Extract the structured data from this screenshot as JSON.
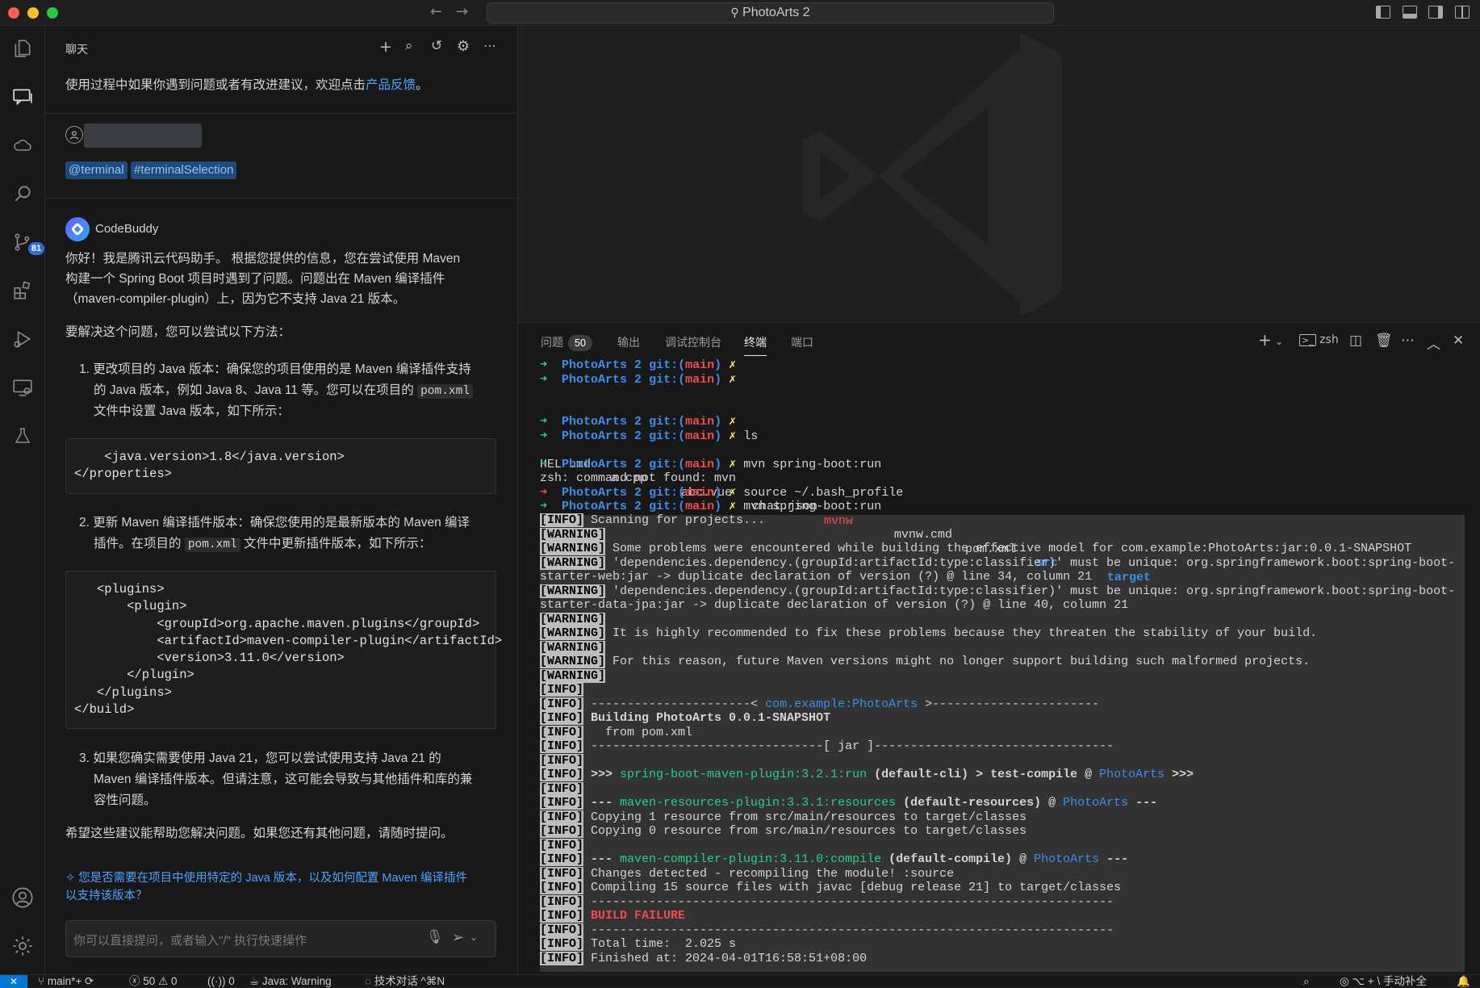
{
  "window": {
    "title": "PhotoArts 2"
  },
  "chat": {
    "header_title": "聊天",
    "feedback_text": "使用过程中如果你遇到问题或者有改进建议，欢迎点击",
    "feedback_link": "产品反馈",
    "feedback_end": "。",
    "tag_terminal": "@terminal",
    "tag_selection": "#terminalSelection",
    "bot_name": "CodeBuddy",
    "intro_1": "你好！我是腾讯云代码助手。  根据您提供的信息，您在尝试使用 Maven",
    "intro_2": "构建一个 Spring Boot 项目时遇到了问题。问题出在 Maven 编译插件",
    "intro_3": "（maven-compiler-plugin）上，因为它不支持 Java 21 版本。",
    "solve_heading": "要解决这个问题，您可以尝试以下方法：",
    "item1_l1": "1. 更改项目的 Java 版本：确保您的项目使用的是 Maven 编译插件支持",
    "item1_l2a": "的 Java 版本，例如 Java 8、Java 11 等。您可以在项目的 ",
    "item1_code": "pom.xml",
    "item1_l3": "文件中设置 Java 版本，如下所示：",
    "code1": "    <java.version>1.8</java.version>\n</properties>",
    "item2_l1": "2. 更新 Maven 编译插件版本：确保您使用的是最新版本的 Maven 编译",
    "item2_l2a": "插件。在项目的 ",
    "item2_code": "pom.xml",
    "item2_l2b": " 文件中更新插件版本，如下所示：",
    "code2": "   <plugins>\n       <plugin>\n           <groupId>org.apache.maven.plugins</groupId>\n           <artifactId>maven-compiler-plugin</artifactId>\n           <version>3.11.0</version>\n       </plugin>\n   </plugins>\n</build>",
    "item3_l1": "3. 如果您确实需要使用 Java 21，您可以尝试使用支持 Java 21 的",
    "item3_l2": "Maven 编译插件版本。但请注意，这可能会导致与其他插件和库的兼",
    "item3_l3": "容性问题。",
    "closing": "希望这些建议能帮助您解决问题。如果您还有其他问题，请随时提问。",
    "suggest_1": "您是否需要在项目中使用特定的 Java 版本，以及如何配置 Maven 编译插件",
    "suggest_2": "以支持该版本？",
    "input_placeholder": "你可以直接提问，或者输入\"/\" 执行快速操作"
  },
  "activity": {
    "scm_badge": "81"
  },
  "panel": {
    "tabs": [
      "问题",
      "输出",
      "调试控制台",
      "终端",
      "端口"
    ],
    "problems_count": "50",
    "active_tab": "终端",
    "shell": "zsh"
  },
  "terminal": {
    "prompt_dir": "PhotoArts 2",
    "prompt_git": "git:(",
    "prompt_branch": "main",
    "prompt_git_end": ")",
    "cmd_ls": "ls",
    "ls_files": [
      "HELP.md",
      "a.cpp",
      "abc.vue",
      "chat.json",
      "mvnw",
      "mvnw.cmd",
      "pom.xml",
      "src",
      "target"
    ],
    "cmd_mvn": "mvn spring-boot:run",
    "not_found": "zsh: command not found: mvn",
    "cmd_source": "source ~/.bash_profile",
    "log": [
      {
        "tag": "[INFO]",
        "text": " Scanning for projects..."
      },
      {
        "tag": "[WARNING]",
        "text": ""
      },
      {
        "tag": "[WARNING]",
        "text": " Some problems were encountered while building the effective model for com.example:PhotoArts:jar:0.0.1-SNAPSHOT"
      },
      {
        "tag": "[WARNING]",
        "text": " 'dependencies.dependency.(groupId:artifactId:type:classifier)' must be unique: org.springframework.boot:spring-boot-"
      },
      {
        "tag": "",
        "text": "starter-web:jar -> duplicate declaration of version (?) @ line 34, column 21"
      },
      {
        "tag": "[WARNING]",
        "text": " 'dependencies.dependency.(groupId:artifactId:type:classifier)' must be unique: org.springframework.boot:spring-boot-"
      },
      {
        "tag": "",
        "text": "starter-data-jpa:jar -> duplicate declaration of version (?) @ line 40, column 21"
      },
      {
        "tag": "[WARNING]",
        "text": ""
      },
      {
        "tag": "[WARNING]",
        "text": " It is highly recommended to fix these problems because they threaten the stability of your build."
      },
      {
        "tag": "[WARNING]",
        "text": ""
      },
      {
        "tag": "[WARNING]",
        "text": " For this reason, future Maven versions might no longer support building such malformed projects."
      },
      {
        "tag": "[WARNING]",
        "text": ""
      },
      {
        "tag": "[INFO]",
        "text": ""
      }
    ],
    "info_sep1_a": " ----------------------< ",
    "info_sep1_b": "com.example:PhotoArts",
    "info_sep1_c": " >-----------------------",
    "building": " Building PhotoArts 0.0.1-SNAPSHOT",
    "from_pom": "   from pom.xml",
    "jar_sep": " --------------------------------[ jar ]---------------------------------",
    "exec_a": " >>> ",
    "exec_b": "spring-boot-maven-plugin:3.2.1:run",
    "exec_c": " (default-cli) > test-compile @ ",
    "exec_d": "PhotoArts",
    "exec_e": " >>>",
    "res_a": " --- ",
    "res_b": "maven-resources-plugin:3.3.1:resources",
    "res_c": " (default-resources) @ ",
    "res_d": "PhotoArts",
    "res_e": " ---",
    "copy1": " Copying 1 resource from src/main/resources to target/classes",
    "copy0": " Copying 0 resource from src/main/resources to target/classes",
    "comp_b": "maven-compiler-plugin:3.11.0:compile",
    "comp_c": " (default-compile) @ ",
    "changes": " Changes detected - recompiling the module! :source",
    "compiling": " Compiling 15 source files with javac [debug release 21] to target/classes",
    "dashes": " ------------------------------------------------------------------------",
    "failure": " BUILD FAILURE",
    "total_time": " Total time:  2.025 s",
    "finished": " Finished at: 2024-04-01T16:58:51+08:00",
    "info_tag": "[INFO]"
  },
  "status": {
    "branch": "main*+",
    "errors": "50",
    "warnings": "0",
    "ports": "0",
    "java": "Java: Warning",
    "chat_shortcut": "技术对话 ^⌘N",
    "completion": "⌥ + \\ 手动补全"
  }
}
